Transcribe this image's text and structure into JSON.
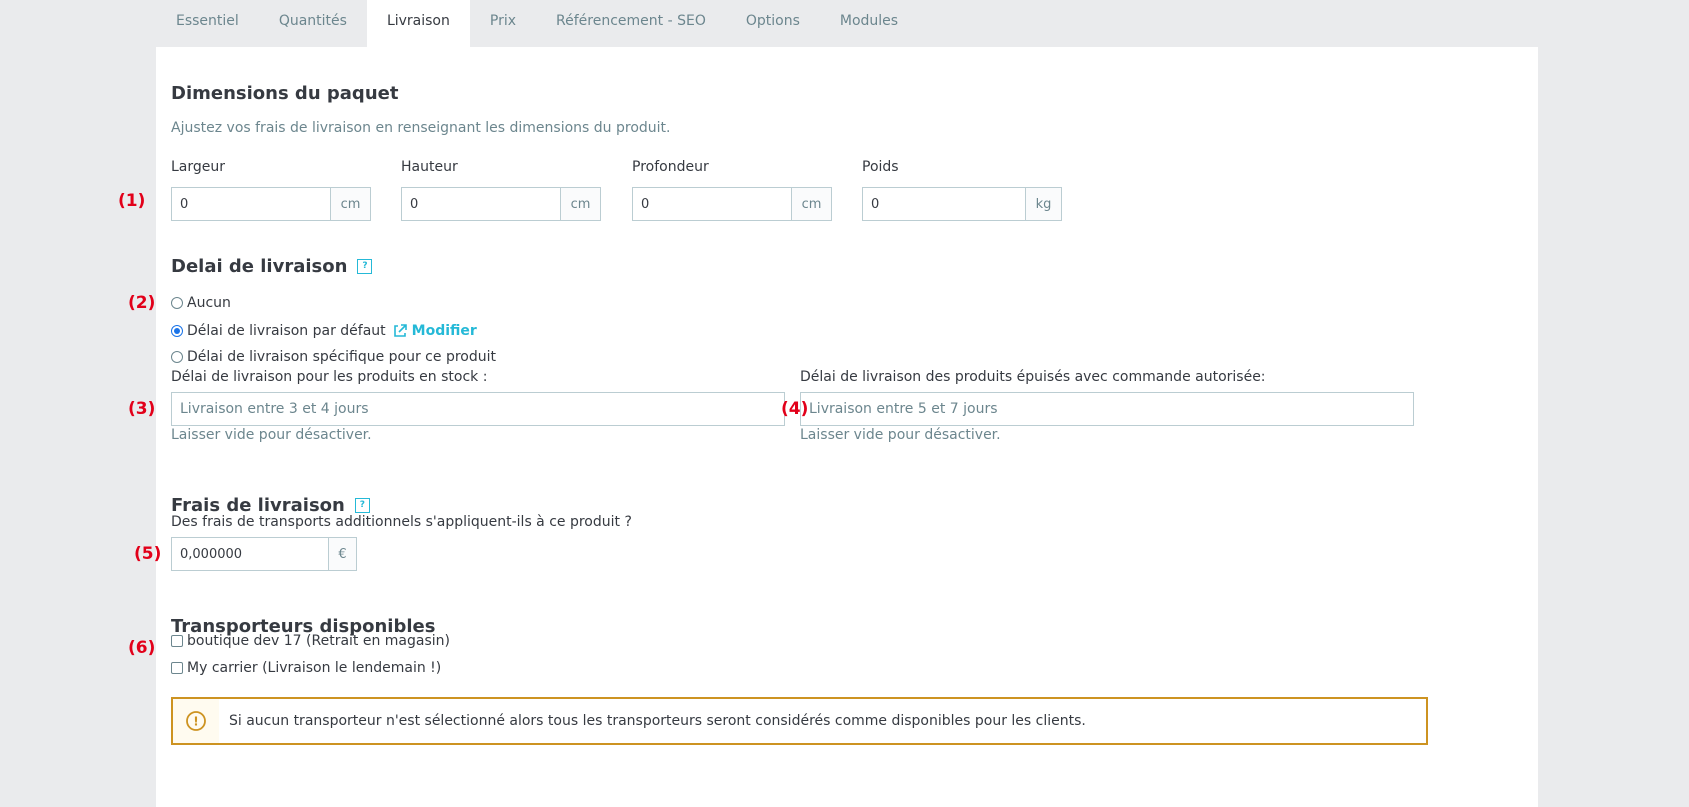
{
  "tabs": [
    {
      "label": "Essentiel",
      "active": false
    },
    {
      "label": "Quantités",
      "active": false
    },
    {
      "label": "Livraison",
      "active": true
    },
    {
      "label": "Prix",
      "active": false
    },
    {
      "label": "Référencement - SEO",
      "active": false
    },
    {
      "label": "Options",
      "active": false
    },
    {
      "label": "Modules",
      "active": false
    }
  ],
  "dimensions": {
    "title": "Dimensions du paquet",
    "description": "Ajustez vos frais de livraison en renseignant les dimensions du produit.",
    "fields": [
      {
        "label": "Largeur",
        "value": "0",
        "unit": "cm"
      },
      {
        "label": "Hauteur",
        "value": "0",
        "unit": "cm"
      },
      {
        "label": "Profondeur",
        "value": "0",
        "unit": "cm"
      },
      {
        "label": "Poids",
        "value": "0",
        "unit": "kg"
      }
    ]
  },
  "delivery_time": {
    "title": "Delai de livraison",
    "help_icon": "?",
    "options": [
      {
        "label": "Aucun",
        "checked": false
      },
      {
        "label": "Délai de livraison par défaut",
        "checked": true
      },
      {
        "label": "Délai de livraison spécifique pour ce produit",
        "checked": false
      }
    ],
    "edit_link": "Modifier",
    "in_stock_label": "Délai de livraison pour les produits en stock :",
    "in_stock_placeholder": "Livraison entre 3 et 4 jours",
    "out_of_stock_label": "Délai de livraison des produits épuisés avec commande autorisée:",
    "out_of_stock_placeholder": "Livraison entre 5 et 7 jours",
    "leave_empty_hint": "Laisser vide pour désactiver."
  },
  "shipping_fees": {
    "title": "Frais de livraison",
    "help_icon": "?",
    "question": "Des frais de transports additionnels s'appliquent-ils à ce produit ?",
    "value": "0,000000",
    "currency": "€"
  },
  "carriers": {
    "title": "Transporteurs disponibles",
    "items": [
      {
        "label": "boutique dev 17 (Retrait en magasin)",
        "checked": false
      },
      {
        "label": "My carrier (Livraison le lendemain !)",
        "checked": false
      }
    ],
    "alert_icon": "!",
    "alert": "Si aucun transporteur n'est sélectionné alors tous les transporteurs seront considérés comme disponibles pour les clients."
  },
  "markers": [
    "(1)",
    "(2)",
    "(3)",
    "(4)",
    "(5)",
    "(6)"
  ],
  "colors": {
    "accent": "#25b9d7",
    "marker": "#e2001a",
    "warning": "#cd9321",
    "radio_checked": "#1a73e8"
  }
}
